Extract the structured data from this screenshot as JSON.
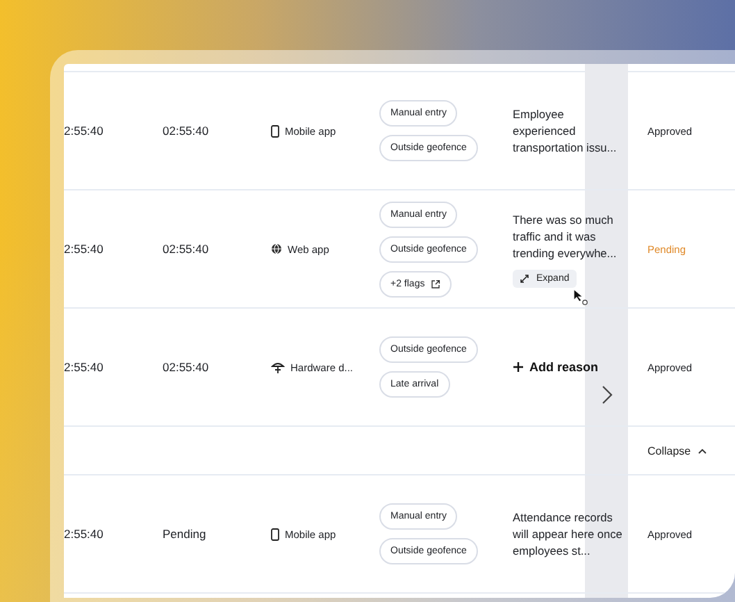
{
  "rows": [
    {
      "times": [
        "2:55:40",
        "02:55:40"
      ],
      "source": {
        "kind": "mobile",
        "label": "Mobile app"
      },
      "flags": [
        {
          "kind": "tag",
          "label": "Manual entry"
        },
        {
          "kind": "tag",
          "label": "Outside geofence"
        }
      ],
      "reason": {
        "kind": "text",
        "text": "Employee experienced transportation issu..."
      },
      "status": {
        "kind": "approved",
        "label": "Approved"
      }
    },
    {
      "times": [
        "2:55:40",
        "02:55:40"
      ],
      "source": {
        "kind": "web",
        "label": "Web app"
      },
      "flags": [
        {
          "kind": "tag",
          "label": "Manual entry"
        },
        {
          "kind": "tag",
          "label": "Outside geofence"
        },
        {
          "kind": "more",
          "label": "+2 flags"
        }
      ],
      "reason": {
        "kind": "text",
        "text": "There was so much traffic and it was trending everywhe...",
        "action": "Expand"
      },
      "status": {
        "kind": "pending",
        "label": "Pending"
      }
    },
    {
      "times": [
        "2:55:40",
        "02:55:40"
      ],
      "source": {
        "kind": "hardware",
        "label": "Hardware d..."
      },
      "flags": [
        {
          "kind": "tag",
          "label": "Outside geofence"
        },
        {
          "kind": "tag",
          "label": "Late arrival"
        }
      ],
      "reason": {
        "kind": "add",
        "text": "Add reason"
      },
      "status": {
        "kind": "approved",
        "label": "Approved"
      }
    },
    {
      "kind": "collapse",
      "label": "Collapse"
    },
    {
      "times": [
        "2:55:40",
        "Pending"
      ],
      "source": {
        "kind": "mobile",
        "label": "Mobile app"
      },
      "flags": [
        {
          "kind": "tag",
          "label": "Manual entry"
        },
        {
          "kind": "tag",
          "label": "Outside geofence"
        }
      ],
      "reason": {
        "kind": "text",
        "text": "Attendance records will appear here once employees st..."
      },
      "status": {
        "kind": "approved",
        "label": "Approved"
      }
    }
  ]
}
